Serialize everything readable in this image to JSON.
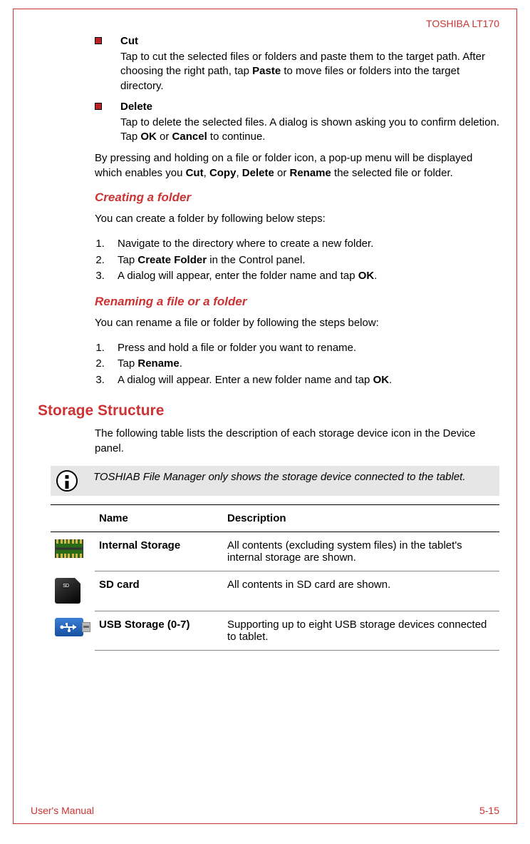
{
  "header": {
    "model": "TOSHIBA LT170"
  },
  "bullets": [
    {
      "title": "Cut",
      "body_parts": [
        "Tap to cut the selected files or folders and paste them to the target path. After choosing the right path, tap ",
        "Paste",
        " to move files or folders into the target directory."
      ]
    },
    {
      "title": "Delete",
      "body_parts": [
        "Tap to delete the selected files. A dialog is shown asking you to confirm deletion. Tap ",
        "OK",
        " or ",
        "Cancel",
        " to continue."
      ]
    }
  ],
  "popup_para_parts": [
    "By pressing and holding on a file or folder icon, a pop-up menu will be displayed which enables you ",
    "Cut",
    ", ",
    "Copy",
    ", ",
    "Delete",
    " or ",
    "Rename",
    " the selected file or folder."
  ],
  "sub1": {
    "title": "Creating a folder",
    "intro": "You can create a folder by following below steps:",
    "steps": [
      {
        "parts": [
          "Navigate to the directory where to create a new folder."
        ]
      },
      {
        "parts": [
          "Tap ",
          "Create Folder",
          " in the Control panel."
        ]
      },
      {
        "parts": [
          "A dialog will appear, enter the folder name and tap ",
          "OK",
          "."
        ]
      }
    ]
  },
  "sub2": {
    "title": "Renaming a file or a folder",
    "intro": "You can rename a file or folder by following the steps below:",
    "steps": [
      {
        "parts": [
          "Press and hold a file or folder you want to rename."
        ]
      },
      {
        "parts": [
          "Tap ",
          "Rename",
          "."
        ]
      },
      {
        "parts": [
          "A dialog will appear. Enter a new folder name and tap ",
          "OK",
          "."
        ]
      }
    ]
  },
  "h2": "Storage Structure",
  "storage_intro": "The following table lists the description of each storage device icon in the Device panel.",
  "note": "TOSHIAB File Manager only shows the storage device connected to the tablet.",
  "table": {
    "headers": {
      "name": "Name",
      "desc": "Description"
    },
    "rows": [
      {
        "name": "Internal Storage",
        "desc": "All contents (excluding system files) in the tablet's internal storage are shown."
      },
      {
        "name": "SD card",
        "desc": "All contents in SD card are shown."
      },
      {
        "name": "USB Storage (0-7)",
        "desc": "Supporting up to eight USB storage devices connected to tablet."
      }
    ]
  },
  "footer": {
    "left": "User's Manual",
    "right": "5-15"
  }
}
